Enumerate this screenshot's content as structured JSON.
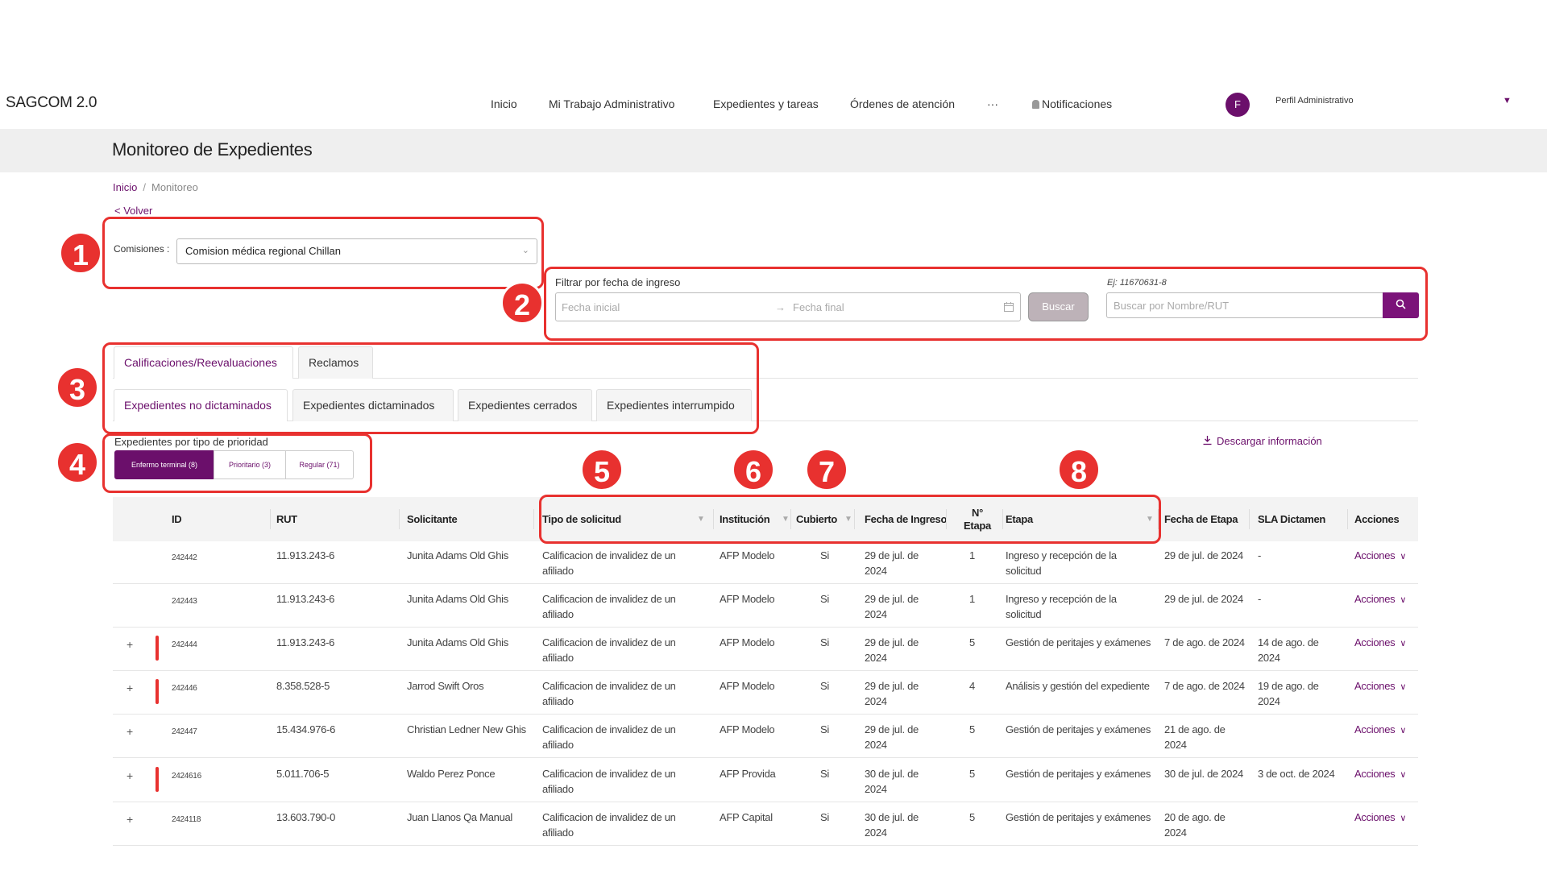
{
  "app": {
    "name": "SAGCOM 2.0",
    "nav": [
      "Inicio",
      "Mi Trabajo Administrativo",
      "Expedientes y tareas",
      "Órdenes de atención",
      "···",
      "Notificaciones"
    ],
    "avatar_letter": "F",
    "profile": "Perfil Administrativo",
    "caret": "▼"
  },
  "page": {
    "title": "Monitoreo de Expedientes",
    "breadcrumb": [
      "Inicio",
      "Monitoreo"
    ],
    "breadcrumb_sep": "/",
    "back": "Volver",
    "back_arrow": "<"
  },
  "filters": {
    "commission_label": "Comisiones :",
    "commission_value": "Comision médica regional Chillan",
    "date_label": "Filtrar por fecha de ingreso",
    "date_start_placeholder": "Fecha inicial",
    "date_arrow": "→",
    "date_end_placeholder": "Fecha final",
    "search_button": "Buscar",
    "search_hint": "Ej: 11670631-8",
    "search_placeholder": "Buscar por Nombre/RUT"
  },
  "tabs": {
    "main": [
      "Calificaciones/Reevaluaciones",
      "Reclamos"
    ],
    "sub": [
      "Expedientes no dictaminados",
      "Expedientes dictaminados",
      "Expedientes cerrados",
      "Expedientes interrumpido"
    ]
  },
  "priority": {
    "label": "Expedientes por tipo de prioridad",
    "segments": [
      "Enfermo terminal (8)",
      "Prioritario (3)",
      "Regular (71)"
    ]
  },
  "download": "Descargar información",
  "callouts": [
    "1",
    "2",
    "3",
    "4",
    "5",
    "6",
    "7",
    "8"
  ],
  "colors": {
    "accent": "#6b0f6b",
    "callout": "#e8312f",
    "priority_bar": "#e8312f"
  },
  "table": {
    "headers": [
      "ID",
      "RUT",
      "Solicitante",
      "Tipo de solicitud",
      "Institución",
      "Cubierto",
      "Fecha de Ingreso",
      "N°",
      "Etapa",
      "Etapa",
      "Fecha de Etapa",
      "SLA Dictamen",
      "Acciones"
    ],
    "rows": [
      {
        "expand": "",
        "priority": false,
        "id": "242442",
        "rut": "11.913.243-6",
        "solicitante": "Junita Adams Old Ghis",
        "tipo": "Calificacion de invalidez de un afiliado",
        "institucion": "AFP Modelo",
        "cubierto": "Si",
        "ingreso": "29 de jul. de 2024",
        "etapa_n": "1",
        "etapa": "Ingreso y recepción de la solicitud",
        "fecha_etapa": "29 de jul. de 2024",
        "sla": "-",
        "acciones": "Acciones"
      },
      {
        "expand": "",
        "priority": false,
        "id": "242443",
        "rut": "11.913.243-6",
        "solicitante": "Junita Adams Old Ghis",
        "tipo": "Calificacion de invalidez de un afiliado",
        "institucion": "AFP Modelo",
        "cubierto": "Si",
        "ingreso": "29 de jul. de 2024",
        "etapa_n": "1",
        "etapa": "Ingreso y recepción de la solicitud",
        "fecha_etapa": "29 de jul. de 2024",
        "sla": "-",
        "acciones": "Acciones"
      },
      {
        "expand": "+",
        "priority": true,
        "id": "242444",
        "rut": "11.913.243-6",
        "solicitante": "Junita Adams Old Ghis",
        "tipo": "Calificacion de invalidez de un afiliado",
        "institucion": "AFP Modelo",
        "cubierto": "Si",
        "ingreso": "29 de jul. de 2024",
        "etapa_n": "5",
        "etapa": "Gestión de peritajes y exámenes",
        "fecha_etapa": "7 de ago. de 2024",
        "sla": "14 de ago. de 2024",
        "acciones": "Acciones"
      },
      {
        "expand": "+",
        "priority": true,
        "id": "242446",
        "rut": "8.358.528-5",
        "solicitante": "Jarrod Swift Oros",
        "tipo": "Calificacion de invalidez de un afiliado",
        "institucion": "AFP Modelo",
        "cubierto": "Si",
        "ingreso": "29 de jul. de 2024",
        "etapa_n": "4",
        "etapa": "Análisis y gestión del expediente",
        "fecha_etapa": "7 de ago. de 2024",
        "sla": "19 de ago. de 2024",
        "acciones": "Acciones"
      },
      {
        "expand": "+",
        "priority": false,
        "id": "242447",
        "rut": "15.434.976-6",
        "solicitante": "Christian Ledner New Ghis",
        "tipo": "Calificacion de invalidez de un afiliado",
        "institucion": "AFP Modelo",
        "cubierto": "Si",
        "ingreso": "29 de jul. de 2024",
        "etapa_n": "5",
        "etapa": "Gestión de peritajes y exámenes",
        "fecha_etapa": "21 de ago. de 2024",
        "sla": "",
        "acciones": "Acciones"
      },
      {
        "expand": "+",
        "priority": true,
        "id": "2424616",
        "rut": "5.011.706-5",
        "solicitante": "Waldo Perez Ponce",
        "tipo": "Calificacion de invalidez de un afiliado",
        "institucion": "AFP Provida",
        "cubierto": "Si",
        "ingreso": "30 de jul. de 2024",
        "etapa_n": "5",
        "etapa": "Gestión de peritajes y exámenes",
        "fecha_etapa": "30 de jul. de 2024",
        "sla": "3 de oct. de 2024",
        "acciones": "Acciones"
      },
      {
        "expand": "+",
        "priority": false,
        "id": "2424118",
        "rut": "13.603.790-0",
        "solicitante": "Juan Llanos Qa Manual",
        "tipo": "Calificacion de invalidez de un afiliado",
        "institucion": "AFP Capital",
        "cubierto": "Si",
        "ingreso": "30 de jul. de 2024",
        "etapa_n": "5",
        "etapa": "Gestión de peritajes y exámenes",
        "fecha_etapa": "20 de ago. de 2024",
        "sla": "",
        "acciones": "Acciones"
      }
    ]
  }
}
